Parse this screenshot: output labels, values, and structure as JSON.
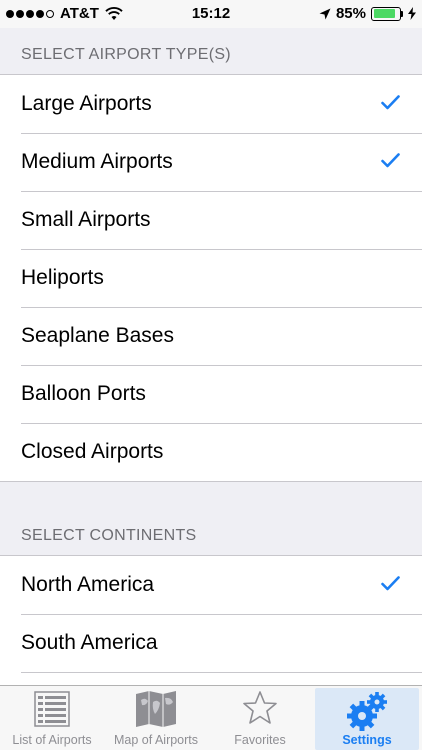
{
  "status_bar": {
    "carrier": "AT&T",
    "time": "15:12",
    "battery_percent": "85%",
    "signal_strength": 4,
    "battery_level": 0.85
  },
  "sections": [
    {
      "header": "SELECT AIRPORT TYPE(S)",
      "items": [
        {
          "label": "Large Airports",
          "checked": true
        },
        {
          "label": "Medium Airports",
          "checked": true
        },
        {
          "label": "Small Airports",
          "checked": false
        },
        {
          "label": "Heliports",
          "checked": false
        },
        {
          "label": "Seaplane Bases",
          "checked": false
        },
        {
          "label": "Balloon Ports",
          "checked": false
        },
        {
          "label": "Closed Airports",
          "checked": false
        }
      ]
    },
    {
      "header": "SELECT CONTINENTS",
      "items": [
        {
          "label": "North America",
          "checked": true
        },
        {
          "label": "South America",
          "checked": false
        }
      ]
    }
  ],
  "tab_bar": {
    "tabs": [
      {
        "label": "List of Airports",
        "icon": "list-icon",
        "active": false
      },
      {
        "label": "Map of Airports",
        "icon": "map-icon",
        "active": false
      },
      {
        "label": "Favorites",
        "icon": "star-icon",
        "active": false
      },
      {
        "label": "Settings",
        "icon": "gears-icon",
        "active": true
      }
    ]
  },
  "colors": {
    "accent": "#1b7ef2",
    "background": "#efeff4",
    "battery": "#4cd964"
  }
}
